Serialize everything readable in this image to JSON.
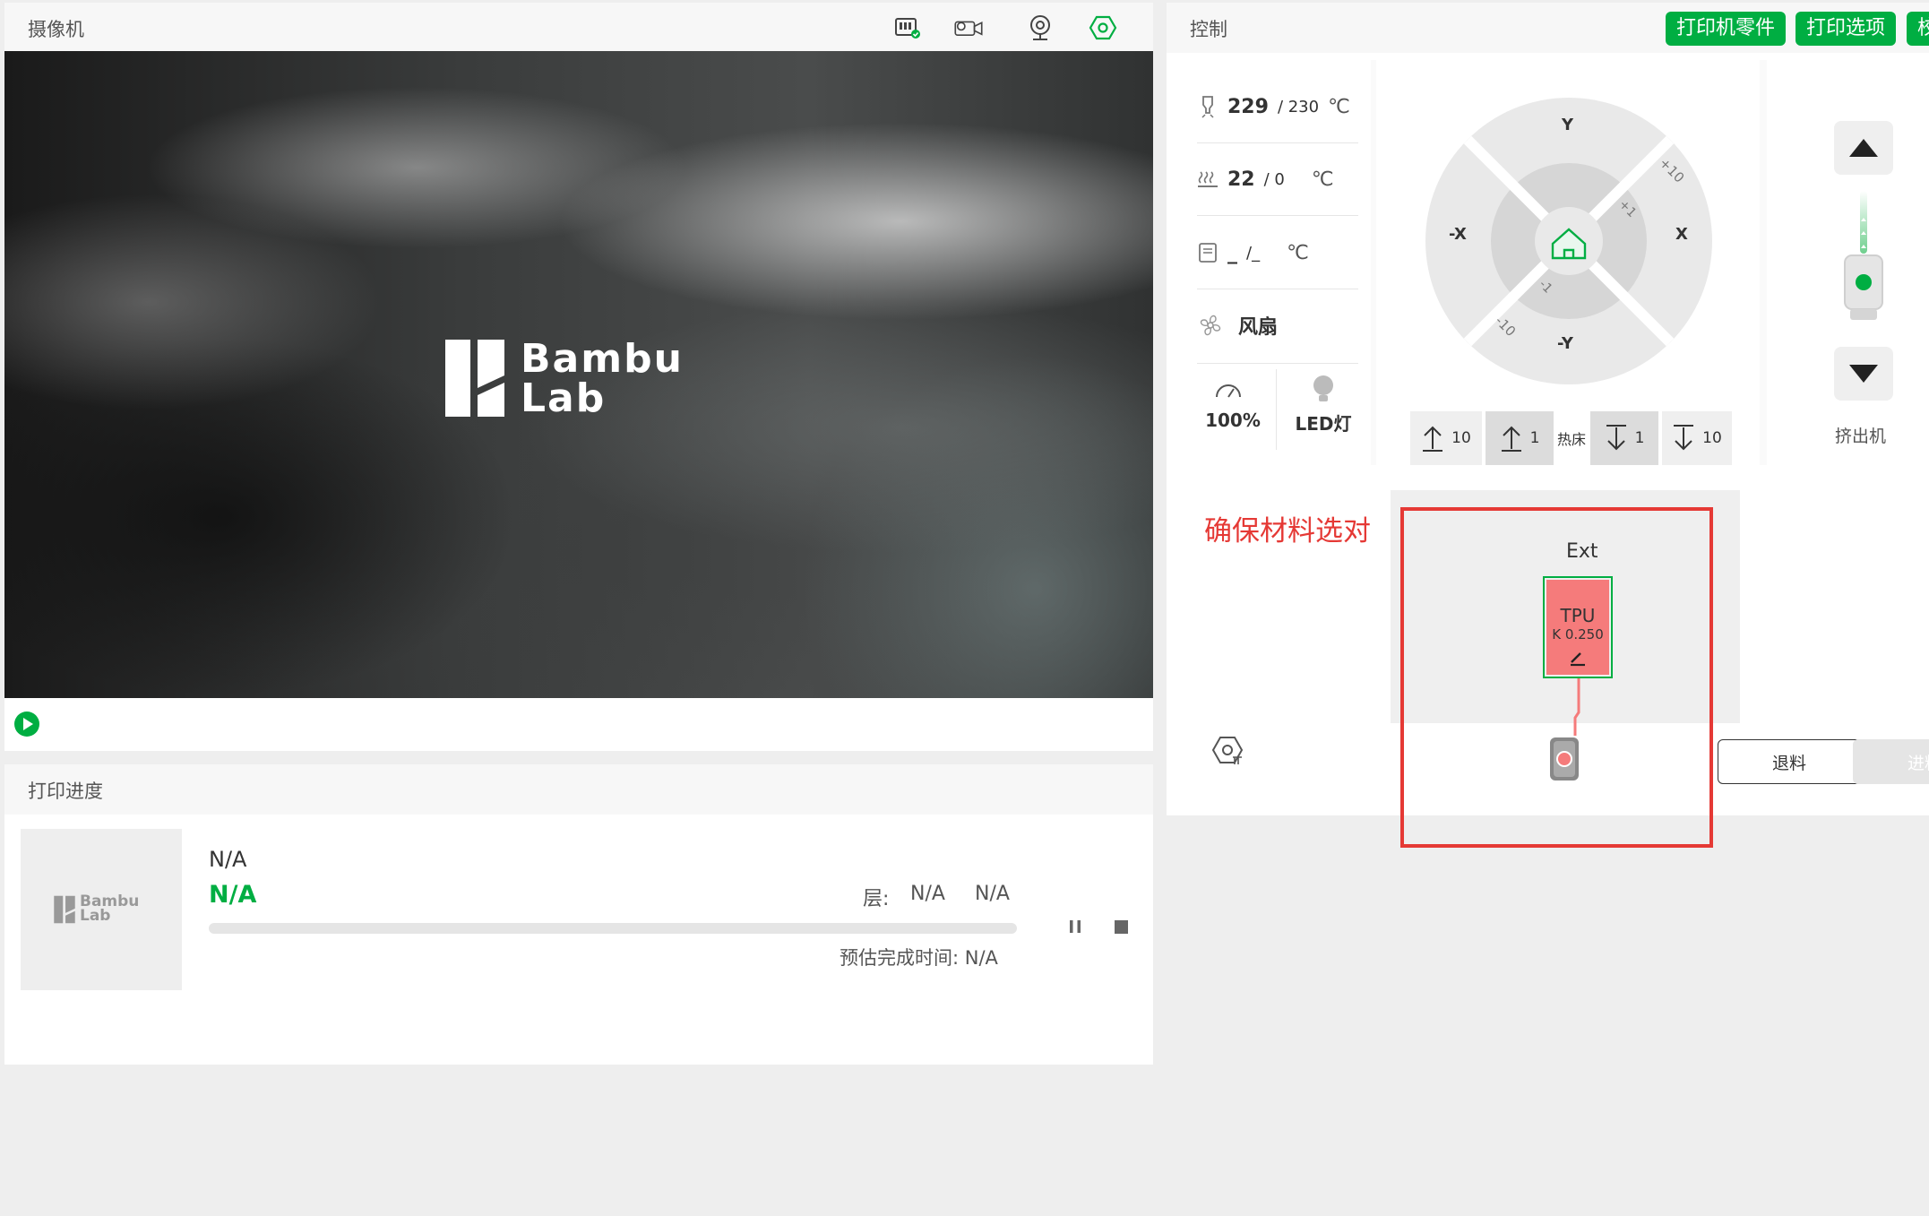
{
  "camera": {
    "title": "摄像机",
    "logo_line1": "Bambu",
    "logo_line2": "Lab"
  },
  "progress": {
    "title": "打印进度",
    "thumb_line1": "Bambu",
    "thumb_line2": "Lab",
    "name": "N/A",
    "status": "N/A",
    "layer_label": "层:",
    "layer_value": "N/A",
    "percent": "N/A",
    "eta": "预估完成时间: N/A",
    "progress_fraction": 0
  },
  "control": {
    "title": "控制",
    "btn_parts": "打印机零件",
    "btn_options": "打印选项",
    "btn_calibrate": "校",
    "nozzle": {
      "current": "229",
      "target": "/ 230",
      "unit": "℃"
    },
    "bed": {
      "current": "22",
      "target": "/ 0",
      "unit": "℃"
    },
    "chamber": {
      "current": "_",
      "target": "/_",
      "unit": "℃"
    },
    "fan_label": "风扇",
    "speed_value": "100%",
    "led_label": "LED灯",
    "jog": {
      "y_plus": "Y",
      "y_minus": "-Y",
      "x_plus": "X",
      "x_minus": "-X",
      "plus10": "+10",
      "plus1": "+1",
      "minus1": "-1",
      "minus10": "-10"
    },
    "bed_buttons": {
      "up10": "10",
      "up1": "1",
      "label": "热床",
      "down1": "1",
      "down10": "10"
    },
    "extruder_label": "挤出机",
    "annotation": "确保材料选对",
    "ext_label": "Ext",
    "filament_type": "TPU",
    "filament_k": "K 0.250",
    "unload_label": "退料",
    "load_label": "进料"
  },
  "colors": {
    "accent": "#00ae42",
    "annotation": "#e53935",
    "filament": "#f57b7b"
  }
}
